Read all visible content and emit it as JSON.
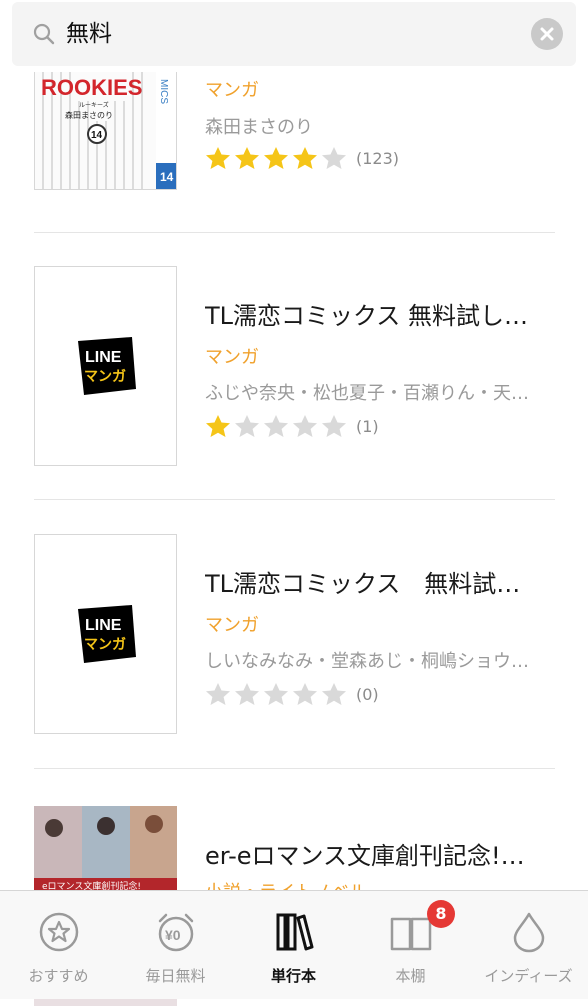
{
  "search": {
    "query": "無料"
  },
  "results": [
    {
      "title": "",
      "genre": "マンガ",
      "authors": "森田まさのり",
      "rating": 4,
      "count": "(123)"
    },
    {
      "title": "TL濡恋コミックス 無料試し…",
      "genre": "マンガ",
      "authors": "ふじや奈央・松也夏子・百瀬りん・天…",
      "rating": 1,
      "count": "(1)"
    },
    {
      "title": "TL濡恋コミックス　無料試…",
      "genre": "マンガ",
      "authors": "しいなみなみ・堂森あじ・桐嶋ショウ…",
      "rating": 0,
      "count": "(0)"
    },
    {
      "title": "er-eロマンス文庫創刊記念!…",
      "genre": "小説・ライトノベル",
      "authors": "",
      "rating": 0,
      "count": ""
    }
  ],
  "covers": {
    "rookies": {
      "title": "ROOKIES",
      "subtitle": "ルーキーズ",
      "author": "森田まさのり",
      "volume": "14",
      "series": "MICS"
    },
    "line_logo": {
      "top": "LINE",
      "bottom": "マンガ"
    },
    "romance_banner": "eロマンス文庫創刊記念!"
  },
  "tabbar": {
    "tabs": [
      {
        "label": "おすすめ"
      },
      {
        "label": "毎日無料",
        "icon_text": "¥0"
      },
      {
        "label": "単行本"
      },
      {
        "label": "本棚"
      },
      {
        "label": "インディーズ"
      }
    ],
    "badge": "8"
  },
  "colors": {
    "accent": "#f0a12c",
    "star": "#f5c518",
    "star_empty": "#d9d9d9",
    "badge": "#e53935"
  }
}
